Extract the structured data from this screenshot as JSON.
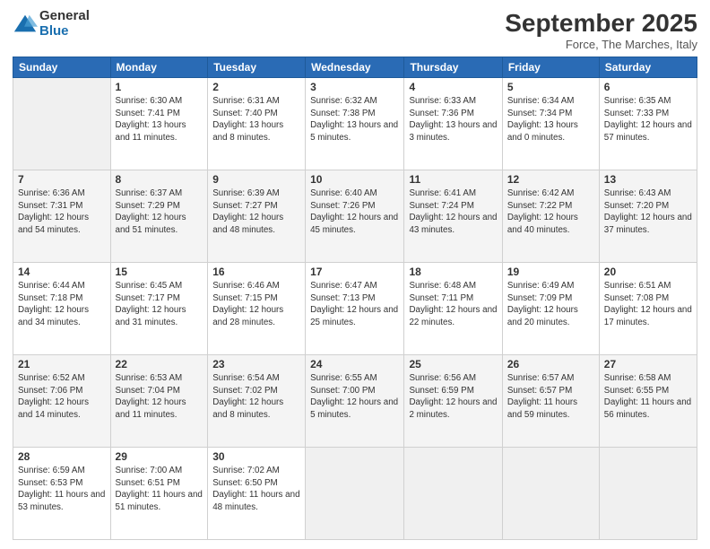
{
  "logo": {
    "general": "General",
    "blue": "Blue"
  },
  "title": "September 2025",
  "location": "Force, The Marches, Italy",
  "days_header": [
    "Sunday",
    "Monday",
    "Tuesday",
    "Wednesday",
    "Thursday",
    "Friday",
    "Saturday"
  ],
  "weeks": [
    [
      {
        "day": "",
        "sunrise": "",
        "sunset": "",
        "daylight": ""
      },
      {
        "day": "1",
        "sunrise": "Sunrise: 6:30 AM",
        "sunset": "Sunset: 7:41 PM",
        "daylight": "Daylight: 13 hours and 11 minutes."
      },
      {
        "day": "2",
        "sunrise": "Sunrise: 6:31 AM",
        "sunset": "Sunset: 7:40 PM",
        "daylight": "Daylight: 13 hours and 8 minutes."
      },
      {
        "day": "3",
        "sunrise": "Sunrise: 6:32 AM",
        "sunset": "Sunset: 7:38 PM",
        "daylight": "Daylight: 13 hours and 5 minutes."
      },
      {
        "day": "4",
        "sunrise": "Sunrise: 6:33 AM",
        "sunset": "Sunset: 7:36 PM",
        "daylight": "Daylight: 13 hours and 3 minutes."
      },
      {
        "day": "5",
        "sunrise": "Sunrise: 6:34 AM",
        "sunset": "Sunset: 7:34 PM",
        "daylight": "Daylight: 13 hours and 0 minutes."
      },
      {
        "day": "6",
        "sunrise": "Sunrise: 6:35 AM",
        "sunset": "Sunset: 7:33 PM",
        "daylight": "Daylight: 12 hours and 57 minutes."
      }
    ],
    [
      {
        "day": "7",
        "sunrise": "Sunrise: 6:36 AM",
        "sunset": "Sunset: 7:31 PM",
        "daylight": "Daylight: 12 hours and 54 minutes."
      },
      {
        "day": "8",
        "sunrise": "Sunrise: 6:37 AM",
        "sunset": "Sunset: 7:29 PM",
        "daylight": "Daylight: 12 hours and 51 minutes."
      },
      {
        "day": "9",
        "sunrise": "Sunrise: 6:39 AM",
        "sunset": "Sunset: 7:27 PM",
        "daylight": "Daylight: 12 hours and 48 minutes."
      },
      {
        "day": "10",
        "sunrise": "Sunrise: 6:40 AM",
        "sunset": "Sunset: 7:26 PM",
        "daylight": "Daylight: 12 hours and 45 minutes."
      },
      {
        "day": "11",
        "sunrise": "Sunrise: 6:41 AM",
        "sunset": "Sunset: 7:24 PM",
        "daylight": "Daylight: 12 hours and 43 minutes."
      },
      {
        "day": "12",
        "sunrise": "Sunrise: 6:42 AM",
        "sunset": "Sunset: 7:22 PM",
        "daylight": "Daylight: 12 hours and 40 minutes."
      },
      {
        "day": "13",
        "sunrise": "Sunrise: 6:43 AM",
        "sunset": "Sunset: 7:20 PM",
        "daylight": "Daylight: 12 hours and 37 minutes."
      }
    ],
    [
      {
        "day": "14",
        "sunrise": "Sunrise: 6:44 AM",
        "sunset": "Sunset: 7:18 PM",
        "daylight": "Daylight: 12 hours and 34 minutes."
      },
      {
        "day": "15",
        "sunrise": "Sunrise: 6:45 AM",
        "sunset": "Sunset: 7:17 PM",
        "daylight": "Daylight: 12 hours and 31 minutes."
      },
      {
        "day": "16",
        "sunrise": "Sunrise: 6:46 AM",
        "sunset": "Sunset: 7:15 PM",
        "daylight": "Daylight: 12 hours and 28 minutes."
      },
      {
        "day": "17",
        "sunrise": "Sunrise: 6:47 AM",
        "sunset": "Sunset: 7:13 PM",
        "daylight": "Daylight: 12 hours and 25 minutes."
      },
      {
        "day": "18",
        "sunrise": "Sunrise: 6:48 AM",
        "sunset": "Sunset: 7:11 PM",
        "daylight": "Daylight: 12 hours and 22 minutes."
      },
      {
        "day": "19",
        "sunrise": "Sunrise: 6:49 AM",
        "sunset": "Sunset: 7:09 PM",
        "daylight": "Daylight: 12 hours and 20 minutes."
      },
      {
        "day": "20",
        "sunrise": "Sunrise: 6:51 AM",
        "sunset": "Sunset: 7:08 PM",
        "daylight": "Daylight: 12 hours and 17 minutes."
      }
    ],
    [
      {
        "day": "21",
        "sunrise": "Sunrise: 6:52 AM",
        "sunset": "Sunset: 7:06 PM",
        "daylight": "Daylight: 12 hours and 14 minutes."
      },
      {
        "day": "22",
        "sunrise": "Sunrise: 6:53 AM",
        "sunset": "Sunset: 7:04 PM",
        "daylight": "Daylight: 12 hours and 11 minutes."
      },
      {
        "day": "23",
        "sunrise": "Sunrise: 6:54 AM",
        "sunset": "Sunset: 7:02 PM",
        "daylight": "Daylight: 12 hours and 8 minutes."
      },
      {
        "day": "24",
        "sunrise": "Sunrise: 6:55 AM",
        "sunset": "Sunset: 7:00 PM",
        "daylight": "Daylight: 12 hours and 5 minutes."
      },
      {
        "day": "25",
        "sunrise": "Sunrise: 6:56 AM",
        "sunset": "Sunset: 6:59 PM",
        "daylight": "Daylight: 12 hours and 2 minutes."
      },
      {
        "day": "26",
        "sunrise": "Sunrise: 6:57 AM",
        "sunset": "Sunset: 6:57 PM",
        "daylight": "Daylight: 11 hours and 59 minutes."
      },
      {
        "day": "27",
        "sunrise": "Sunrise: 6:58 AM",
        "sunset": "Sunset: 6:55 PM",
        "daylight": "Daylight: 11 hours and 56 minutes."
      }
    ],
    [
      {
        "day": "28",
        "sunrise": "Sunrise: 6:59 AM",
        "sunset": "Sunset: 6:53 PM",
        "daylight": "Daylight: 11 hours and 53 minutes."
      },
      {
        "day": "29",
        "sunrise": "Sunrise: 7:00 AM",
        "sunset": "Sunset: 6:51 PM",
        "daylight": "Daylight: 11 hours and 51 minutes."
      },
      {
        "day": "30",
        "sunrise": "Sunrise: 7:02 AM",
        "sunset": "Sunset: 6:50 PM",
        "daylight": "Daylight: 11 hours and 48 minutes."
      },
      {
        "day": "",
        "sunrise": "",
        "sunset": "",
        "daylight": ""
      },
      {
        "day": "",
        "sunrise": "",
        "sunset": "",
        "daylight": ""
      },
      {
        "day": "",
        "sunrise": "",
        "sunset": "",
        "daylight": ""
      },
      {
        "day": "",
        "sunrise": "",
        "sunset": "",
        "daylight": ""
      }
    ]
  ]
}
